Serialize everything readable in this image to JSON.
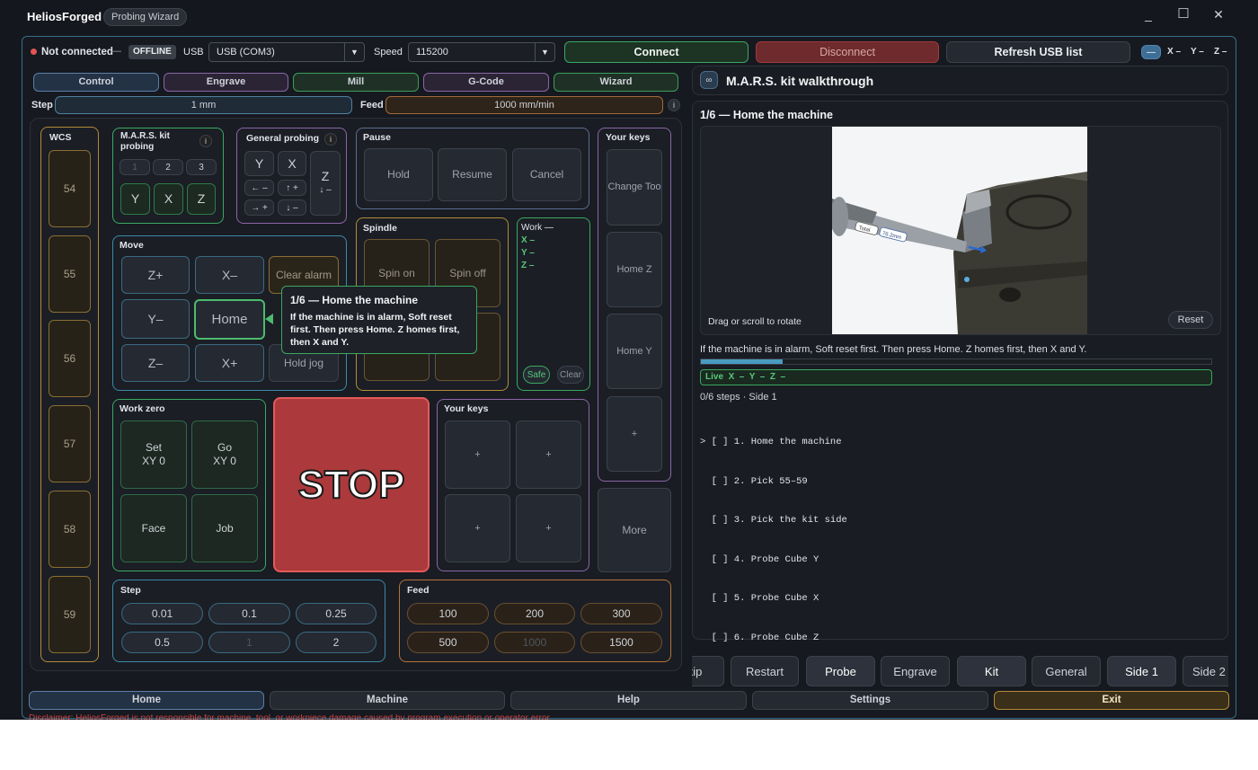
{
  "app": {
    "title": "HeliosForged",
    "badge": "Probing Wizard"
  },
  "window_controls": {
    "minimize": "_",
    "maximize": "☐",
    "close": "✕"
  },
  "connection": {
    "status_text": "Not connected",
    "dash": "—",
    "offline_badge": "OFFLINE",
    "usb_label": "USB",
    "usb_value": "USB (COM3)",
    "speed_label": "Speed",
    "speed_value": "115200",
    "connect": "Connect",
    "disconnect": "Disconnect",
    "refresh": "Refresh USB list",
    "axis_x": "X –",
    "axis_y": "Y –",
    "axis_z": "Z –",
    "colors": {
      "status_dot": "#e05555",
      "connect": "#2f9e5a",
      "disconnect": "#a33a3a"
    }
  },
  "mode_tabs": [
    "Control",
    "Engrave",
    "Mill",
    "G-Code",
    "Wizard"
  ],
  "step_bar": {
    "label": "Step",
    "value": "1 mm"
  },
  "feed_bar": {
    "label": "Feed",
    "value": "1000 mm/min"
  },
  "wcs": {
    "title": "WCS",
    "items": [
      "54",
      "55",
      "56",
      "57",
      "58",
      "59"
    ]
  },
  "mars": {
    "title": "M.A.R.S. kit probing",
    "sides": [
      "1",
      "2",
      "3"
    ],
    "probes": [
      "Y",
      "X",
      "Z"
    ]
  },
  "general_probing": {
    "title": "General probing",
    "y": "Y",
    "x": "X",
    "z": "Z",
    "z_dir": "↓ –",
    "b1": "← –",
    "b2": "↑ +",
    "b3": "→ +",
    "b4": "↓ –"
  },
  "pause": {
    "title": "Pause",
    "hold": "Hold",
    "resume": "Resume",
    "cancel": "Cancel"
  },
  "your_keys_right": {
    "title": "Your keys",
    "keys": [
      "Change Too",
      "Home Z",
      "Home Y",
      "+"
    ]
  },
  "more": "More",
  "move": {
    "title": "Move",
    "zp": "Z+",
    "xm": "X–",
    "clear_alarm": "Clear alarm",
    "ym": "Y–",
    "home": "Home",
    "zm": "Z–",
    "xp": "X+",
    "hold_jog": "Hold jog"
  },
  "spindle": {
    "title": "Spindle",
    "spin_on": "Spin on",
    "spin_off": "Spin off",
    "plus": "+",
    "minus": "–"
  },
  "work": {
    "title": "Work —",
    "x": "X –",
    "y": "Y –",
    "z": "Z –",
    "safe": "Safe",
    "clear": "Clear"
  },
  "tooltip": {
    "title": "1/6 — Home the machine",
    "body": "If the machine is in alarm, Soft reset first. Then press Home. Z homes first, then X and Y."
  },
  "work_zero": {
    "title": "Work zero",
    "set": "Set\nXY 0",
    "go": "Go\nXY 0",
    "face": "Face",
    "job": "Job"
  },
  "stop": "STOP",
  "your_keys_mid": {
    "title": "Your keys",
    "keys": [
      "+",
      "+",
      "+",
      "+"
    ]
  },
  "step_presets": {
    "title": "Step",
    "values": [
      "0.01",
      "0.1",
      "0.25",
      "0.5",
      "1",
      "2"
    ]
  },
  "feed_presets": {
    "title": "Feed",
    "values": [
      "100",
      "200",
      "300",
      "500",
      "1000",
      "1500"
    ]
  },
  "walkthrough": {
    "title": "M.A.R.S. kit walkthrough",
    "step_title": "1/6 — Home the machine",
    "viewer_hint": "Drag or scroll to rotate",
    "reset": "Reset",
    "model_label_1": "Total",
    "model_label_2": "76.2mm",
    "description": "If the machine is in alarm, Soft reset first. Then press Home. Z homes first, then X and Y.",
    "progress": 0.16,
    "live": "Live  X  –  Y  –  Z  –",
    "steps_summary": "0/6 steps · Side 1",
    "checklist": [
      "> [ ] 1. Home the machine",
      "  [ ] 2. Pick 55–59",
      "  [ ] 3. Pick the kit side",
      "  [ ] 4. Probe Cube Y",
      "  [ ] 5. Probe Cube X",
      "  [ ] 6. Probe Cube Z"
    ]
  },
  "wizard_buttons": [
    "kip",
    "Restart",
    "Probe",
    "Engrave",
    "Kit",
    "General",
    "Side 1",
    "Side 2"
  ],
  "bottom_nav": [
    "Home",
    "Machine",
    "Help",
    "Settings",
    "Exit"
  ],
  "disclaimer": "Disclaimer: HeliosForged is not responsible for machine, tool, or workpiece damage caused by program execution or operator error."
}
